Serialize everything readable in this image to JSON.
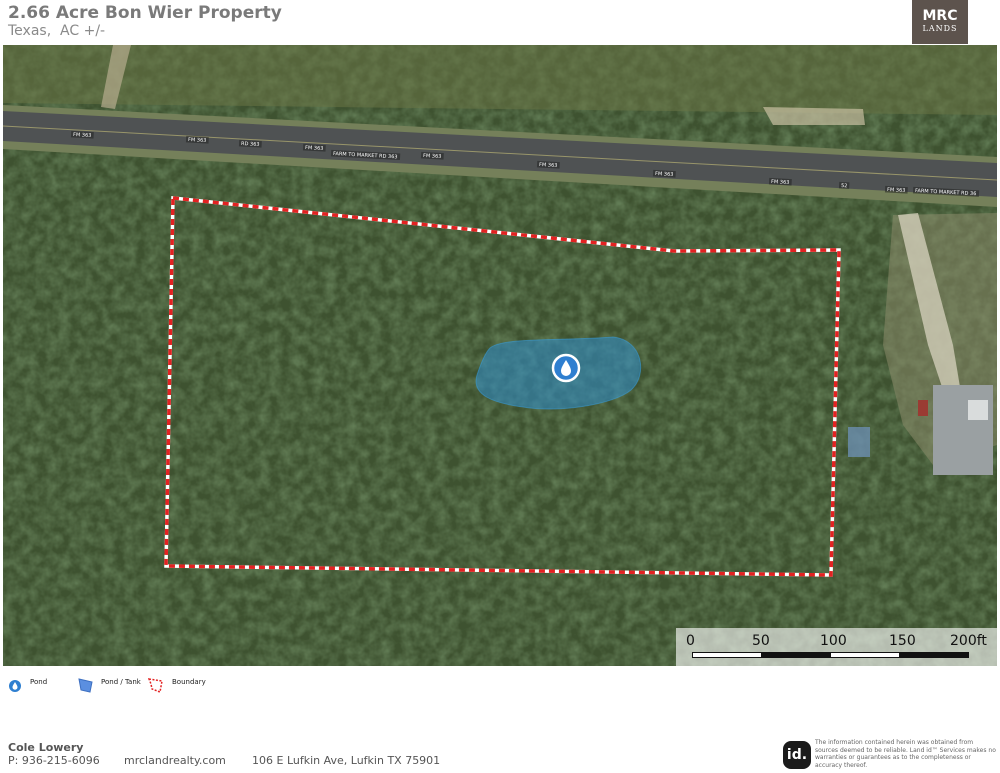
{
  "header": {
    "title": "2.66 Acre Bon Wier Property",
    "subtitle": "Texas,  AC +/-",
    "logo_main": "MRC",
    "logo_sub": "LANDS"
  },
  "map": {
    "road_labels": [
      "FM 363",
      "FM 363",
      "RD 363",
      "FM 363",
      "FARM TO MARKET RD 363",
      "FM 363",
      "FM 363",
      "FM 363",
      "FM 363",
      "52",
      "FM 363",
      "FARM TO MARKET RD 36"
    ],
    "boundary_color": "#e32222",
    "pond_color": "#2f8fd0",
    "pond_icon": "water-drop-icon",
    "scale": {
      "labels": [
        "0",
        "50",
        "100",
        "150",
        "200ft"
      ]
    }
  },
  "legend": {
    "items": [
      {
        "label": "Pond",
        "icon": "pond-marker-icon"
      },
      {
        "label": "Pond / Tank",
        "icon": "pond-tank-polygon-icon"
      },
      {
        "label": "Boundary",
        "icon": "boundary-polygon-icon"
      }
    ]
  },
  "footer": {
    "agent_name": "Cole Lowery",
    "agent_phone": "P: 936-215-6096",
    "website": "mrclandrealty.com",
    "address": "106 E Lufkin Ave, Lufkin TX 75901",
    "id_logo": "id.",
    "disclaimer": "The information contained herein was obtained from sources deemed to be reliable. Land id™ Services makes no warranties or guarantees as to the completeness or accuracy thereof."
  }
}
